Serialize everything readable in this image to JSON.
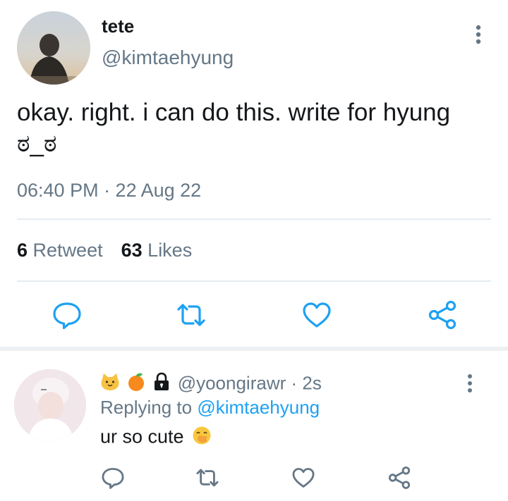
{
  "main_tweet": {
    "display_name": "tete",
    "handle": "@kimtaehyung",
    "text_line1": "okay. right. i can do this. write for hyung",
    "text_line2": "ಠ_ಠ",
    "timestamp": "06:40 PM · 22 Aug 22",
    "retweet_count": "6",
    "retweet_label": "Retweet",
    "likes_count": "63",
    "likes_label": "Likes"
  },
  "reply": {
    "emojis": [
      "cat-face-emoji",
      "tangerine-emoji",
      "lock-emoji"
    ],
    "handle": "@yoongirawr",
    "time": "· 2s",
    "replying_prefix": "Replying to",
    "replying_to": "@kimtaehyung",
    "text": "ur so cute"
  },
  "icons": {
    "actions": [
      "reply-icon",
      "retweet-icon",
      "like-icon",
      "share-icon"
    ],
    "more": "more-vertical-icon"
  },
  "colors": {
    "icon_blue": "#657786",
    "link_blue": "#1da1f2",
    "text_primary": "#14171a",
    "text_secondary": "#657786",
    "divider": "#e6ecf0"
  }
}
